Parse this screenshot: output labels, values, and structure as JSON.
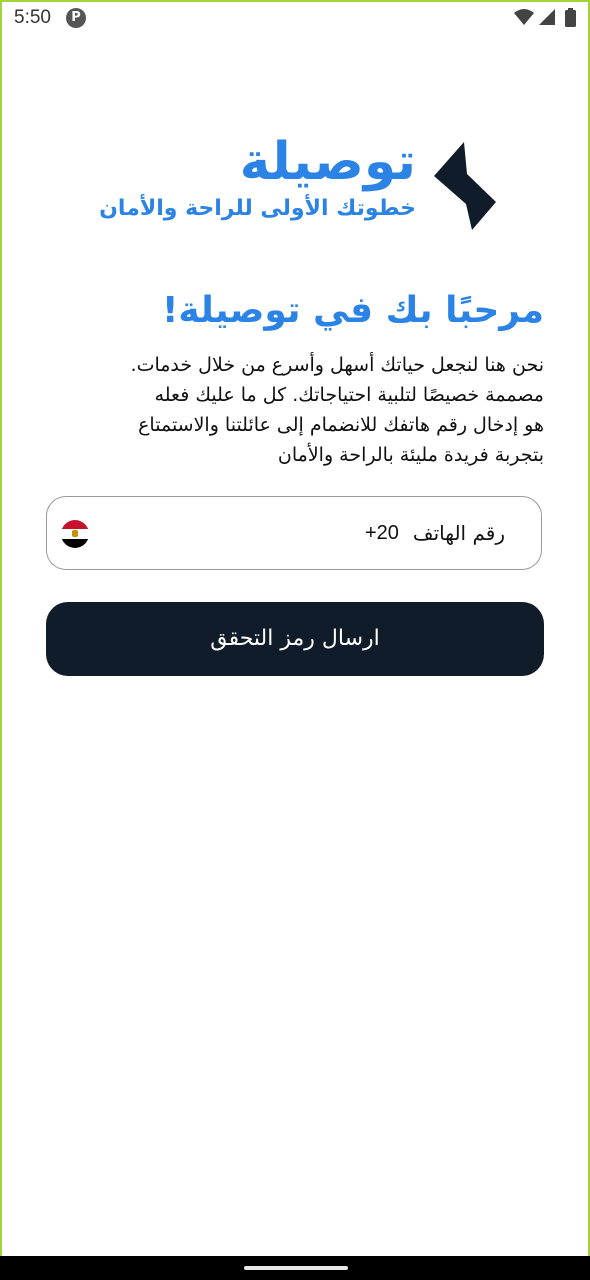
{
  "status_bar": {
    "time": "5:50",
    "app_notification_glyph": "P",
    "icons": [
      "wifi-icon",
      "signal-icon",
      "battery-icon"
    ]
  },
  "logo": {
    "title": "توصيلة",
    "tagline": "خطوتك الأولى للراحة والأمان",
    "icon": "lightning-bolt-icon",
    "color": "#2b84e5",
    "icon_color": "#101c2a"
  },
  "welcome": {
    "title": "مرحبًا بك في توصيلة!",
    "lines": [
      "نحن هنا لنجعل حياتك أسهل وأسرع من خلال خدمات.",
      "مصممة خصيصًا لتلبية احتياجاتك. كل ما عليك فعله",
      "هو إدخال رقم هاتفك للانضمام إلى عائلتنا والاستمتاع",
      "بتجربة فريدة مليئة بالراحة والأمان"
    ]
  },
  "phone_input": {
    "label": "رقم الهاتف",
    "country_code": "+20",
    "flag": "egypt-flag-icon"
  },
  "send_button": {
    "label": "ارسال رمز التحقق",
    "background": "#101c2a"
  }
}
